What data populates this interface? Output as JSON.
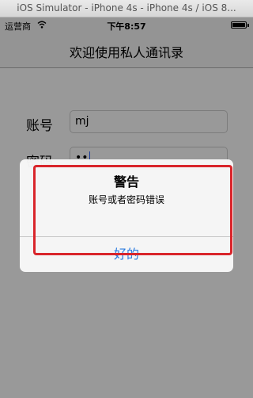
{
  "window": {
    "title": "iOS Simulator - iPhone 4s - iPhone 4s / iOS 8..."
  },
  "status_bar": {
    "carrier": "运营商",
    "time": "下午8:57",
    "wifi_icon": "wifi-icon",
    "battery_icon": "battery-icon"
  },
  "nav": {
    "title": "欢迎使用私人通讯录"
  },
  "form": {
    "account_label": "账号",
    "account_value": "mj",
    "password_label": "密码",
    "password_value": "••"
  },
  "alert": {
    "title": "警告",
    "message": "账号或者密码错误",
    "button_label": "好的"
  },
  "colors": {
    "accent": "#2b7be0",
    "highlight": "#d9252b"
  }
}
